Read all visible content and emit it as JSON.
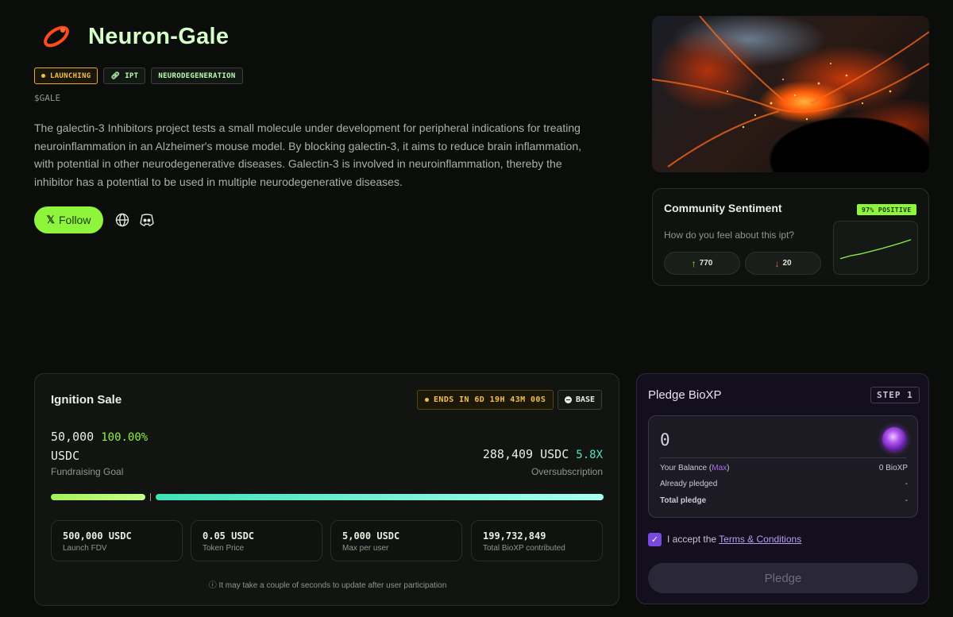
{
  "project": {
    "name": "Neuron-Gale",
    "logo_icon": "orbit-ring-icon",
    "tags": [
      "LAUNCHING",
      "IPT",
      "NEURODEGENERATION"
    ],
    "ticker": "$GALE",
    "description": "The galectin-3 Inhibitors project tests a small molecule under development for peripheral indications for treating neuroinflammation in an Alzheimer's mouse model. By blocking galectin-3, it aims to reduce brain inflammation, with potential in other neurodegenerative diseases. Galectin-3 is involved in neuroinflammation, thereby the inhibitor has a potential to be used in multiple neurodegenerative diseases.",
    "follow_x": "𝕏",
    "follow_label": "Follow"
  },
  "sentiment": {
    "title": "Community Sentiment",
    "badge": "97% POSITIVE",
    "question": "How do you feel about this ipt?",
    "up_arrow": "↑",
    "up_count": "770",
    "down_arrow": "↓",
    "down_count": "20",
    "trend": [
      0.2,
      0.28,
      0.33,
      0.4,
      0.47,
      0.55,
      0.63,
      0.72
    ]
  },
  "sale": {
    "title": "Ignition Sale",
    "ends": "ENDS IN 6D 19H 43M 00S",
    "network": "BASE",
    "goal_amount": "50,000",
    "goal_pct": "100.00%",
    "goal_currency": "USDC",
    "goal_label": "Fundraising Goal",
    "raised": "288,409 USDC",
    "multiplier": "5.8X",
    "raised_label": "Oversubscription",
    "stats": [
      {
        "value": "500,000 USDC",
        "label": "Launch FDV"
      },
      {
        "value": "0.05 USDC",
        "label": "Token Price"
      },
      {
        "value": "5,000 USDC",
        "label": "Max per user"
      },
      {
        "value": "199,732,849",
        "label": "Total BioXP contributed"
      }
    ],
    "note": "ⓘ It may take a couple of seconds to update after user participation"
  },
  "pledge": {
    "title": "Pledge BioXP",
    "step": "STEP 1",
    "amount": "0",
    "balance_label": "Your Balance (",
    "max_label": "Max",
    "balance_close": ")",
    "balance_value": "0 BioXP",
    "already_label": "Already pledged",
    "already_value": "-",
    "total_label": "Total pledge",
    "total_value": "-",
    "checkbox": "✓",
    "accept_text": "I accept the ",
    "terms_link": "Terms & Conditions",
    "button": "Pledge"
  },
  "colors": {
    "accent": "#8ef43c",
    "warning": "#f2c04a",
    "teal": "#4fe3c1",
    "purple": "#7a4ae0"
  }
}
